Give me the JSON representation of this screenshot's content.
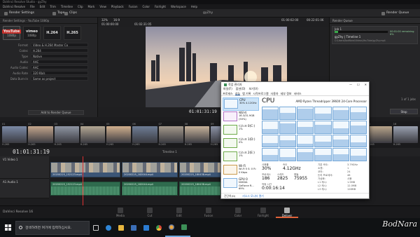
{
  "window": {
    "title": "DaVinci Resolve Studio - gyZhy"
  },
  "menu": [
    "DaVinci Resolve",
    "File",
    "Edit",
    "Trim",
    "Timeline",
    "Clip",
    "Mark",
    "View",
    "Playback",
    "Fusion",
    "Color",
    "Fairlight",
    "Workspace",
    "Help"
  ],
  "toolbar": {
    "render_settings": "Render Settings",
    "tape": "Tape",
    "clips": "Clips",
    "project": "gyZhy",
    "render_queue": "Render Queue",
    "zoom": "32%",
    "layout": "16:9"
  },
  "render_settings": {
    "header": "Render Settings - YouTube 1080p",
    "presets": [
      {
        "logo": "YouTube",
        "label": "1080p"
      },
      {
        "logo": "vimeo",
        "label": "1080p"
      },
      {
        "logo": "H.264",
        "label": ""
      },
      {
        "logo": "H.265",
        "label": ""
      }
    ],
    "rows": [
      {
        "k": "Format",
        "v": "Video & H.264 Master Co"
      },
      {
        "k": "Codec",
        "v": "H.264"
      },
      {
        "k": "Type",
        "v": "Native"
      },
      {
        "k": "Audio",
        "v": "AAC"
      },
      {
        "k": "Audio Codec",
        "v": "AAC"
      },
      {
        "k": "Audio Rate",
        "v": "320 Kb/s"
      },
      {
        "k": "Data Burn-in",
        "v": "Same as project"
      }
    ],
    "add_queue": "Add to Render Queue"
  },
  "viewer": {
    "tc_left": "01:00:00:00",
    "tc_dur": "01:02:31:05",
    "tc_right": "01:00:02:00",
    "tc_right2": "00:22:01:06",
    "tc_center": "01:01:31:19"
  },
  "render_queue": {
    "header": "Render Queue",
    "job": "Job 1",
    "job_name": "gyZhy | Timeline 1",
    "job_path": "C:\\Users\\BodNara\\Videos\\YouTube\\gyZhy.mp4",
    "progress_text": "00:01:00 remaining  6%",
    "progress_value": 0.06,
    "count": "1 of 1 jobs",
    "stop": "Stop"
  },
  "clips": [
    {
      "n": "01",
      "c": "H.265"
    },
    {
      "n": "02",
      "c": "H.265"
    },
    {
      "n": "03",
      "c": "H.265"
    },
    {
      "n": "04",
      "c": "H.265"
    },
    {
      "n": "05",
      "c": "H.265"
    },
    {
      "n": "06",
      "c": "H.265"
    },
    {
      "n": "07",
      "c": "H.265"
    },
    {
      "n": "08",
      "c": "H.265"
    },
    {
      "n": "09",
      "c": "H.265"
    },
    {
      "n": "10",
      "c": "H.265"
    },
    {
      "n": "11",
      "c": "H.265"
    },
    {
      "n": "12",
      "c": "H.265"
    },
    {
      "n": "13",
      "c": "H.265"
    },
    {
      "n": "14",
      "c": "H.265"
    },
    {
      "n": "15",
      "c": "H.265"
    },
    {
      "n": "16",
      "c": "H.265"
    }
  ],
  "timeline": {
    "timecode": "01:01:31:19",
    "timeline_label": "Timeline 1",
    "video_track": "V1   Video 1",
    "audio_track": "A1   Audio 1",
    "clip_names": [
      "20200225_152123.mp4",
      "20200225_182044.mp4",
      "20200225_180438.mp4",
      "20200225_185405.mp4"
    ]
  },
  "pages": [
    "Media",
    "Cut",
    "Edit",
    "Fusion",
    "Color",
    "Fairlight",
    "Deliver"
  ],
  "app_name": "DaVinci Resolve 16",
  "taskbar": {
    "search": "검색하려면 여기에 입력하십시오."
  },
  "watermark": "BodNara",
  "task_manager": {
    "title": "작업 관리자",
    "menu": [
      "파일(F)",
      "옵션(O)",
      "보기(V)"
    ],
    "tabs": [
      "프로세스",
      "성능",
      "앱 기록",
      "시작프로그램",
      "사용자",
      "세부 정보",
      "서비스"
    ],
    "active_tab": 1,
    "side": [
      {
        "t": "CPU",
        "s": "30% 4.12GHz",
        "kind": "cpu"
      },
      {
        "t": "메모리",
        "s": "16.3/31.9GB (50%)",
        "kind": "mem"
      },
      {
        "t": "디스크 0(C:)",
        "s": "1%",
        "kind": "disk"
      },
      {
        "t": "디스크 1(D:)",
        "s": "0%",
        "kind": "disk"
      },
      {
        "t": "디스크 2(E:)",
        "s": "1%",
        "kind": "disk"
      },
      {
        "t": "Wi-Fi",
        "s": "Wi-Fi 5  S: 0 R: 0 Kbps",
        "kind": "net"
      },
      {
        "t": "GPU 0",
        "s": "NVIDIA GeForce R... 69%",
        "kind": "cpu"
      }
    ],
    "cpu_label": "CPU",
    "cpu_model": "AMD Ryzen Threadripper 3960X 24-Core Processor",
    "core_load": [
      0.85,
      0.55,
      0.9,
      0.45,
      0.75,
      0.6,
      0.35,
      0.8,
      0.5,
      0.7,
      0.4,
      0.65,
      0.3,
      0.55,
      0.25,
      0.45,
      0.6,
      0.35,
      0.5,
      0.3,
      0.7,
      0.45,
      0.55,
      0.4
    ],
    "stats": {
      "util_label": "사용률",
      "util": "30%",
      "speed_label": "속도",
      "speed": "4.12GHz",
      "proc_label": "프로세스",
      "proc": "186",
      "thread_label": "스레드",
      "thread": "2825",
      "handle_label": "핸들",
      "handle": "75955",
      "uptime_label": "작동 시간",
      "uptime": "0:00:16:14",
      "base_label": "기본 속도:",
      "base": "3.79GHz",
      "sockets_label": "소켓:",
      "sockets": "1",
      "cores_label": "코어:",
      "cores": "24",
      "lp_label": "논리 프로세서:",
      "lp": "48",
      "virt_label": "가상화:",
      "virt": "사용",
      "l1_label": "L1 캐시:",
      "l1": "1.5MB",
      "l2_label": "L2 캐시:",
      "l2": "12.0MB",
      "l3_label": "L3 캐시:",
      "l3": "128MB"
    },
    "foot_less": "간단히(D)",
    "foot_link": "리소스 모니터 열기"
  }
}
